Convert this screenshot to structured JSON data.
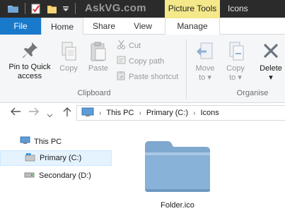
{
  "titlebar": {
    "watermark": "AskVG.com",
    "context_tab_group": "Picture Tools",
    "window_title": "Icons"
  },
  "tabs": {
    "file": "File",
    "home": "Home",
    "share": "Share",
    "view": "View",
    "manage": "Manage"
  },
  "ribbon": {
    "clipboard": {
      "pin_label_1": "Pin to Quick",
      "pin_label_2": "access",
      "copy": "Copy",
      "paste": "Paste",
      "cut": "Cut",
      "copy_path": "Copy path",
      "paste_shortcut": "Paste shortcut",
      "group_label": "Clipboard"
    },
    "organise": {
      "move_to": "Move",
      "move_to_2": "to",
      "copy_to": "Copy",
      "copy_to_2": "to",
      "delete": "Delete",
      "group_label": "Organise"
    }
  },
  "address": {
    "crumbs": [
      "This PC",
      "Primary (C:)",
      "Icons"
    ]
  },
  "navpane": {
    "items": [
      "This PC",
      "Primary (C:)",
      "Secondary (D:)"
    ]
  },
  "content": {
    "files": [
      "Folder.ico"
    ]
  },
  "colors": {
    "file_tab": "#1979ca",
    "picture_tools": "#f4e88a",
    "titlebar": "#2b2b2b",
    "selection": "#e5f3ff"
  }
}
